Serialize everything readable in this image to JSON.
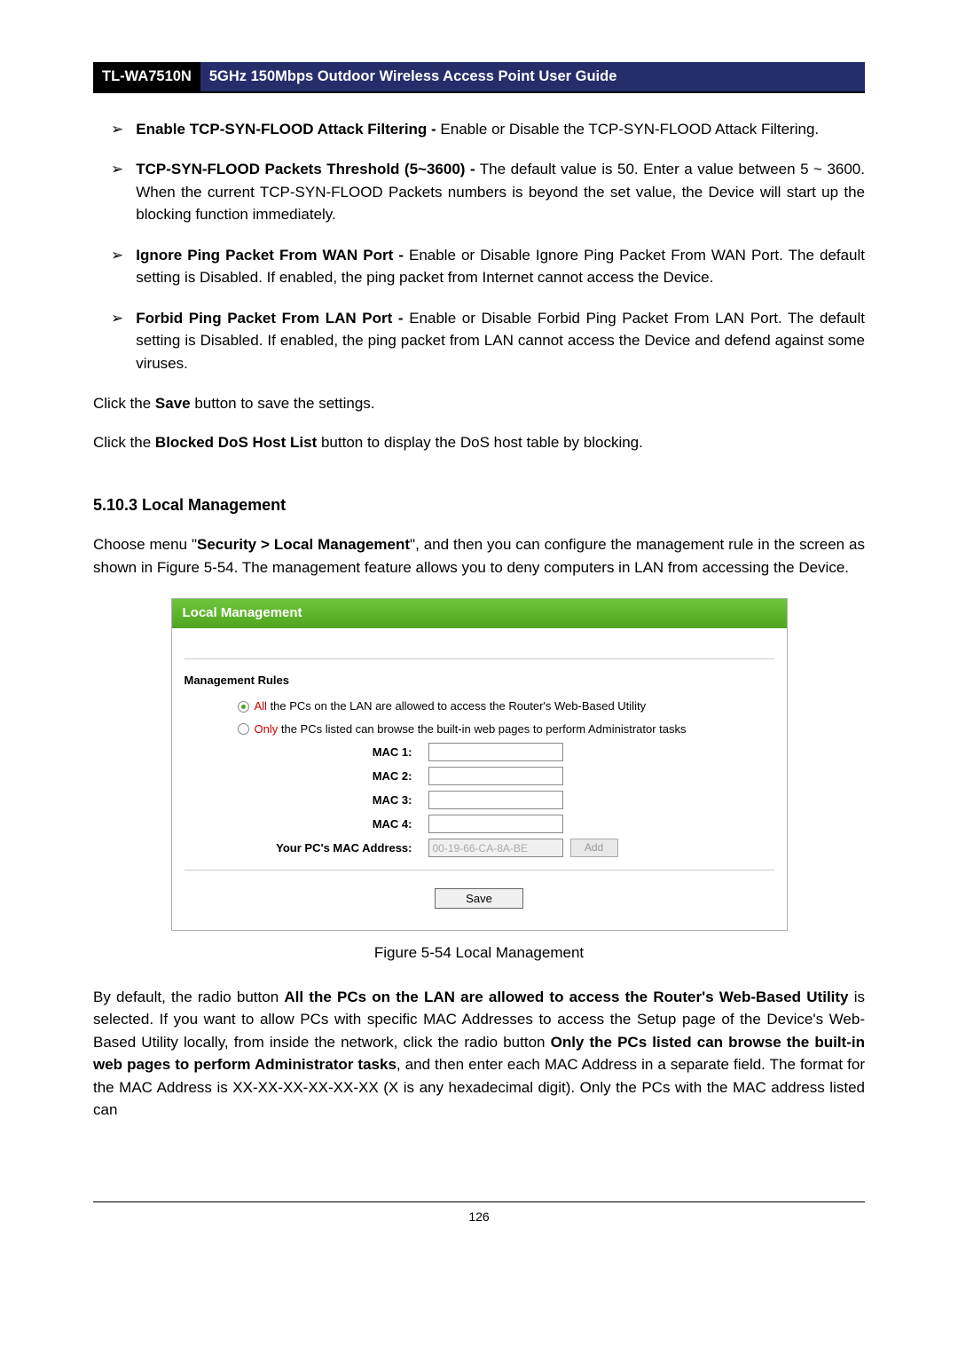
{
  "header": {
    "model": "TL-WA7510N",
    "title": "5GHz 150Mbps Outdoor Wireless Access Point User Guide"
  },
  "bullets": [
    {
      "bold": "Enable TCP-SYN-FLOOD Attack Filtering -",
      "rest": " Enable or Disable the TCP-SYN-FLOOD Attack Filtering."
    },
    {
      "bold": "TCP-SYN-FLOOD Packets Threshold (5~3600) -",
      "rest": " The default value is 50. Enter a value between 5 ~ 3600. When the current TCP-SYN-FLOOD Packets numbers is beyond the set value, the Device will start up the blocking function immediately."
    },
    {
      "bold": "Ignore Ping Packet From WAN Port -",
      "rest": " Enable or Disable Ignore Ping Packet From WAN Port. The default setting is Disabled. If enabled, the ping packet from Internet cannot access the Device."
    },
    {
      "bold": "Forbid Ping Packet From LAN Port -",
      "rest": " Enable or Disable Forbid Ping Packet From LAN Port. The default setting is Disabled. If enabled, the ping packet from LAN cannot access the Device and defend against some viruses."
    }
  ],
  "para_save": {
    "pre": "Click the ",
    "bold": "Save",
    "post": " button to save the settings."
  },
  "para_blocked": {
    "pre": "Click the ",
    "bold": "Blocked DoS Host List",
    "post": " button to display the DoS host table by blocking."
  },
  "section_heading": "5.10.3 Local Management",
  "para_choose_pre": "Choose menu \"",
  "para_choose_bold": "Security > Local Management",
  "para_choose_post": "\", and then you can configure the management rule in the screen as shown in Figure 5-54. The management feature allows you to deny computers in LAN from accessing the Device.",
  "figure": {
    "title": "Local Management",
    "rules_heading": "Management Rules",
    "radio1_highlight": "All",
    "radio1_rest": " the PCs on the LAN are allowed to access the Router's Web-Based Utility",
    "radio2_highlight": "Only",
    "radio2_rest": " the PCs listed can browse the built-in web pages to perform Administrator tasks",
    "mac1": "MAC 1:",
    "mac2": "MAC 2:",
    "mac3": "MAC 3:",
    "mac4": "MAC 4:",
    "yourpc_label": "Your PC's MAC Address:",
    "yourpc_value": "00-19-66-CA-8A-BE",
    "add_btn": "Add",
    "save_btn": "Save"
  },
  "figure_caption": "Figure 5-54 Local Management",
  "para_default_1": "By default, the radio button ",
  "para_default_bold1": "All the PCs on the LAN are allowed to access the Router's Web-Based Utility",
  "para_default_2": " is selected. If you want to allow PCs with specific MAC Addresses to access the Setup page of the Device's Web-Based Utility locally, from inside the network, click the radio button ",
  "para_default_bold2": "Only the PCs listed can browse the built-in web pages to perform Administrator tasks",
  "para_default_3": ", and then enter each MAC Address in a separate field. The format for the MAC Address is XX-XX-XX-XX-XX-XX (X is any hexadecimal digit). Only the PCs with the MAC address listed can",
  "page_number": "126"
}
